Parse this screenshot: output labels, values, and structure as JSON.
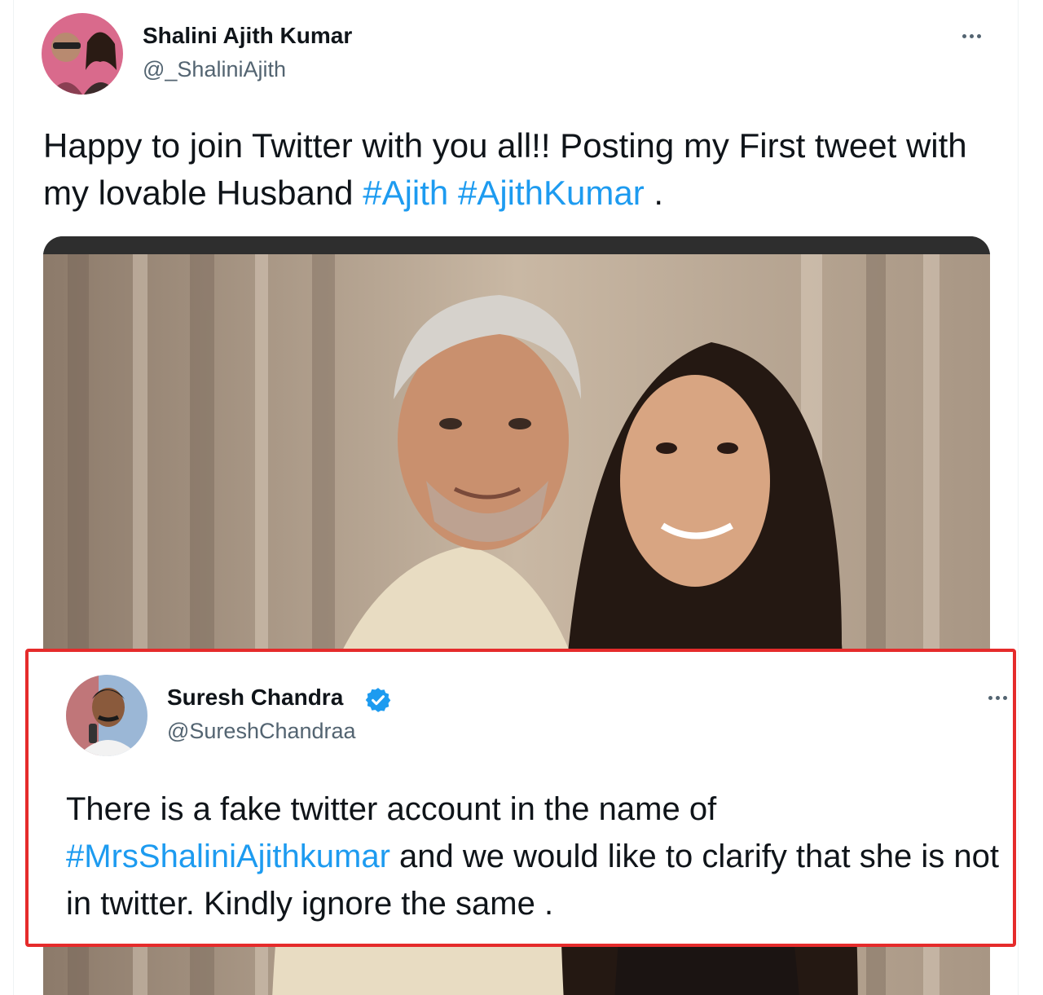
{
  "main_tweet": {
    "author_name": "Shalini Ajith Kumar",
    "author_handle": "@_ShaliniAjith",
    "text_part1": "Happy to join Twitter with you all!! Posting my First tweet with my lovable Husband ",
    "hashtag1": "#Ajith",
    "hashtag2": "#AjithKumar",
    "text_end": " .",
    "more_icon": "more-horizontal-icon",
    "media_description_icon": "photo"
  },
  "reply_tweet": {
    "author_name": "Suresh Chandra",
    "author_handle": "@SureshChandraa",
    "verified_icon": "verified-badge-icon",
    "hashtag": "#MrsShaliniAjithkumar",
    "text_before": "There is a fake twitter account in the name of ",
    "text_after": " and we would like to clarify that she is not in twitter. Kindly ignore the same .",
    "more_icon": "more-horizontal-icon"
  },
  "colors": {
    "link": "#1d9bf0",
    "text": "#0f1419",
    "secondary": "#536471",
    "highlight_border": "#e52b2b"
  }
}
